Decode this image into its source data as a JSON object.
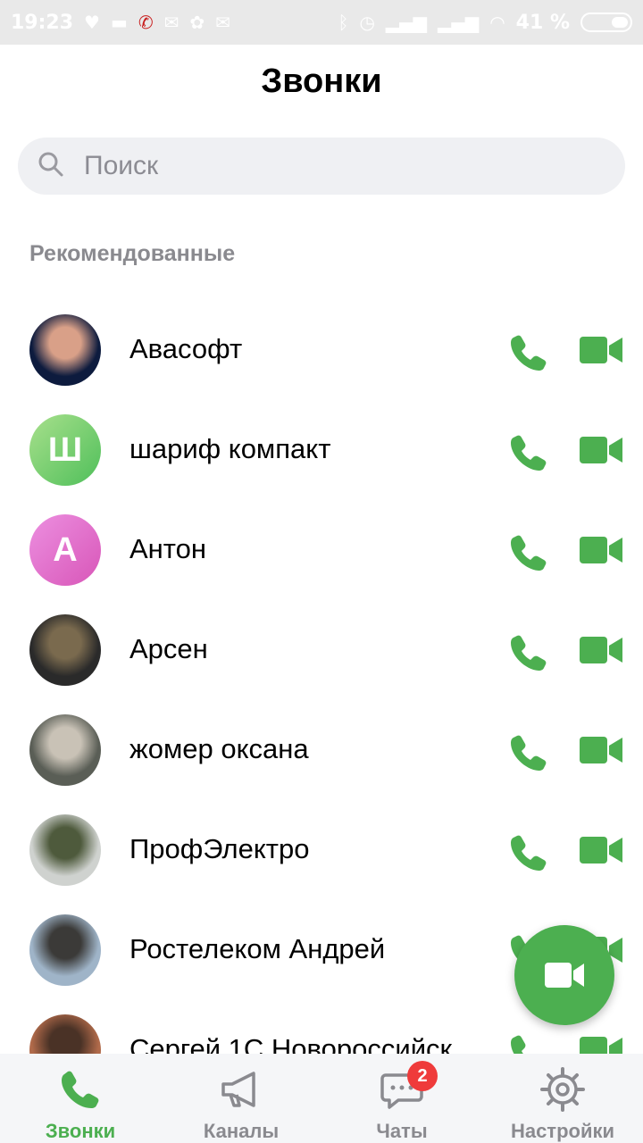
{
  "status_bar": {
    "time": "19:23",
    "battery": "41 %",
    "left_icons": [
      "location-icon",
      "message-icon",
      "missed-call-icon",
      "mail-icon",
      "clover-icon",
      "mail-icon"
    ],
    "right_icons": [
      "bluetooth-icon",
      "alarm-icon",
      "signal-icon",
      "signal-icon",
      "wifi-icon"
    ]
  },
  "header": {
    "title": "Звонки"
  },
  "search": {
    "placeholder": "Поиск"
  },
  "section": {
    "label": "Рекомендованные"
  },
  "contacts": [
    {
      "name": "Авасофт",
      "avatar": "photo",
      "colors": [
        "#0d1b3e",
        "#d9a088"
      ]
    },
    {
      "name": "шариф компакт",
      "avatar": "letter",
      "letter": "Ш",
      "colors": [
        "#a8e08c",
        "#4fbf5a"
      ]
    },
    {
      "name": "Антон",
      "avatar": "letter",
      "letter": "А",
      "colors": [
        "#ec8fe0",
        "#d856b8"
      ]
    },
    {
      "name": "Арсен",
      "avatar": "photo",
      "colors": [
        "#2a2a2a",
        "#7a6a4e"
      ]
    },
    {
      "name": "жомер оксана",
      "avatar": "photo",
      "colors": [
        "#5a5e56",
        "#c9c2b6"
      ]
    },
    {
      "name": "ПрофЭлектро",
      "avatar": "photo",
      "colors": [
        "#cfd2cf",
        "#4e5a3c"
      ]
    },
    {
      "name": "Ростелеком Андрей",
      "avatar": "photo",
      "colors": [
        "#9fb4c8",
        "#3b3a38"
      ]
    },
    {
      "name": "Сергей 1С Новороссийск",
      "avatar": "photo",
      "colors": [
        "#b06a4a",
        "#4a3226"
      ]
    }
  ],
  "accent": "#4caf50",
  "tabs": [
    {
      "label": "Звонки",
      "icon": "phone-icon",
      "active": true
    },
    {
      "label": "Каналы",
      "icon": "megaphone-icon",
      "active": false
    },
    {
      "label": "Чаты",
      "icon": "chat-icon",
      "active": false,
      "badge": "2"
    },
    {
      "label": "Настройки",
      "icon": "gear-icon",
      "active": false
    }
  ]
}
